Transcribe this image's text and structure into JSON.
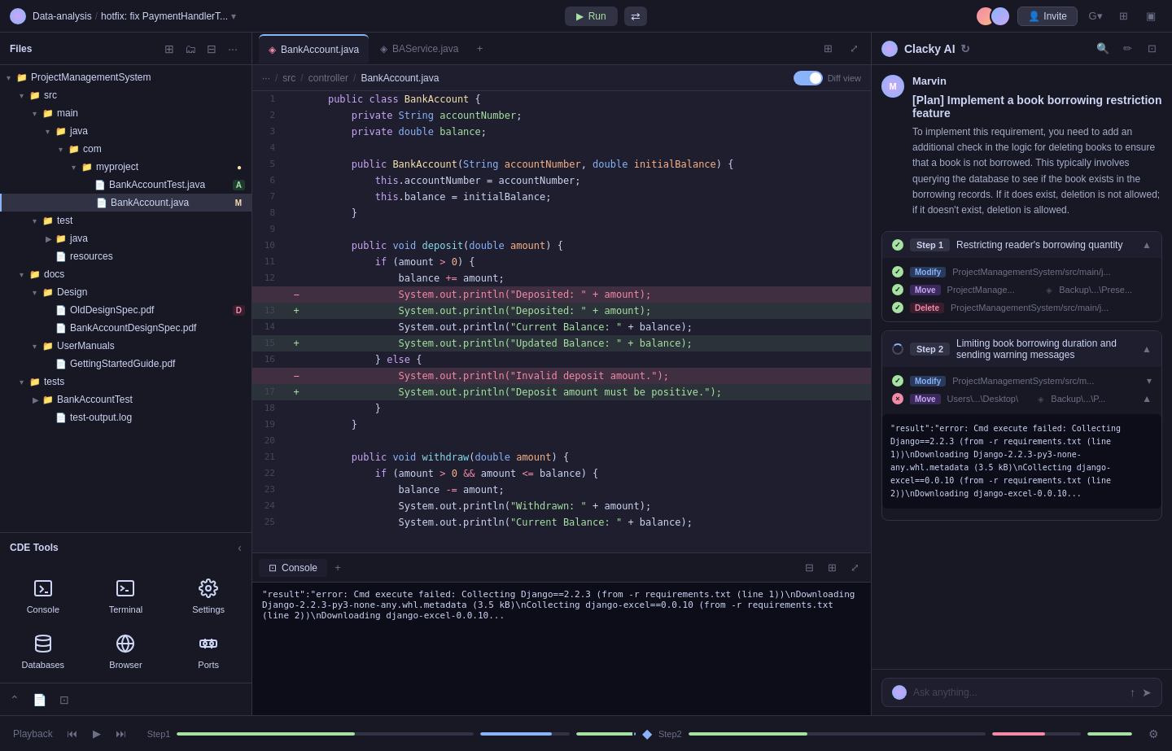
{
  "topbar": {
    "logo": "logo",
    "breadcrumb": [
      "Data-analysis",
      "/",
      "hotfix: fix PaymentHandlerT..."
    ],
    "run_label": "Run",
    "invite_label": "Invite"
  },
  "sidebar": {
    "title": "Files",
    "tree": [
      {
        "id": "root",
        "name": "ProjectManagementSystem",
        "type": "folder",
        "depth": 0,
        "open": true
      },
      {
        "id": "src",
        "name": "src",
        "type": "folder",
        "depth": 1,
        "open": true
      },
      {
        "id": "main",
        "name": "main",
        "type": "folder",
        "depth": 2,
        "open": true
      },
      {
        "id": "java",
        "name": "java",
        "type": "folder",
        "depth": 3,
        "open": true
      },
      {
        "id": "com",
        "name": "com",
        "type": "folder",
        "depth": 4,
        "open": true
      },
      {
        "id": "myproject",
        "name": "myproject",
        "type": "folder",
        "depth": 5,
        "open": true,
        "badge": "●",
        "badge_color": "yellow"
      },
      {
        "id": "BankAccountTest",
        "name": "BankAccountTest.java",
        "type": "java",
        "depth": 6,
        "badge": "A",
        "badge_color": "green"
      },
      {
        "id": "BankAccount",
        "name": "BankAccount.java",
        "type": "java",
        "depth": 6,
        "active": true,
        "badge": "M",
        "badge_color": "yellow"
      },
      {
        "id": "test",
        "name": "test",
        "type": "folder",
        "depth": 2,
        "open": true
      },
      {
        "id": "testjava",
        "name": "java",
        "type": "folder",
        "depth": 3,
        "open": false
      },
      {
        "id": "resources",
        "name": "resources",
        "type": "file",
        "depth": 3
      },
      {
        "id": "docs",
        "name": "docs",
        "type": "folder",
        "depth": 1,
        "open": true
      },
      {
        "id": "Design",
        "name": "Design",
        "type": "folder",
        "depth": 2,
        "open": true
      },
      {
        "id": "OldDesign",
        "name": "OldDesignSpec.pdf",
        "type": "pdf",
        "depth": 3,
        "badge": "D",
        "badge_color": "red"
      },
      {
        "id": "BankDesign",
        "name": "BankAccountDesignSpec.pdf",
        "type": "pdf",
        "depth": 3
      },
      {
        "id": "UserManuals",
        "name": "UserManuals",
        "type": "folder",
        "depth": 2,
        "open": true
      },
      {
        "id": "GettingStarted",
        "name": "GettingStartedGuide.pdf",
        "type": "pdf",
        "depth": 3
      },
      {
        "id": "tests",
        "name": "tests",
        "type": "folder",
        "depth": 1,
        "open": true
      },
      {
        "id": "BankAccountTestDir",
        "name": "BankAccountTest",
        "type": "folder",
        "depth": 2,
        "open": false
      },
      {
        "id": "testOutput",
        "name": "test-output.log",
        "type": "log",
        "depth": 3
      }
    ]
  },
  "cde_tools": {
    "title": "CDE Tools",
    "items": [
      {
        "id": "console",
        "label": "Console",
        "icon": "console"
      },
      {
        "id": "terminal",
        "label": "Terminal",
        "icon": "terminal"
      },
      {
        "id": "settings",
        "label": "Settings",
        "icon": "settings"
      },
      {
        "id": "databases",
        "label": "Databases",
        "icon": "databases"
      },
      {
        "id": "browser",
        "label": "Browser",
        "icon": "browser"
      },
      {
        "id": "ports",
        "label": "Ports",
        "icon": "ports"
      }
    ]
  },
  "editor": {
    "tabs": [
      {
        "id": "bankaccount",
        "label": "BankAccount.java",
        "active": true
      },
      {
        "id": "baservice",
        "label": "BAService.java",
        "active": false
      }
    ],
    "breadcrumb": [
      "src",
      "/",
      "controller",
      "/",
      "BankAccount.java"
    ],
    "diff_view_label": "Diff view",
    "diff_enabled": true,
    "lines": [
      {
        "num": 1,
        "content": "    public class BankAccount {",
        "diff": ""
      },
      {
        "num": 2,
        "content": "        private String accountNumber;",
        "diff": ""
      },
      {
        "num": 3,
        "content": "        private double balance;",
        "diff": ""
      },
      {
        "num": 4,
        "content": "",
        "diff": ""
      },
      {
        "num": 5,
        "content": "        public BankAccount(String accountNumber, double initialBalance) {",
        "diff": ""
      },
      {
        "num": 6,
        "content": "            this.accountNumber = accountNumber;",
        "diff": ""
      },
      {
        "num": 7,
        "content": "            this.balance = initialBalance;",
        "diff": ""
      },
      {
        "num": 8,
        "content": "        }",
        "diff": ""
      },
      {
        "num": 9,
        "content": "",
        "diff": ""
      },
      {
        "num": 10,
        "content": "        public void deposit(double amount) {",
        "diff": ""
      },
      {
        "num": 11,
        "content": "            if (amount > 0) {",
        "diff": ""
      },
      {
        "num": 12,
        "content": "                balance += amount;",
        "diff": ""
      },
      {
        "num": "",
        "content": "                System.out.println(\"Deposited: \" + amount);",
        "diff": "removed"
      },
      {
        "num": 13,
        "content": "                System.out.println(\"Deposited: \" + amount);",
        "diff": "added"
      },
      {
        "num": 14,
        "content": "                System.out.println(\"Current Balance: \" + balance);",
        "diff": ""
      },
      {
        "num": 15,
        "content": "                System.out.println(\"Updated Balance: \" + balance);",
        "diff": "added"
      },
      {
        "num": 16,
        "content": "            } else {",
        "diff": ""
      },
      {
        "num": "",
        "content": "                System.out.println(\"Invalid deposit amount.\");",
        "diff": "removed"
      },
      {
        "num": 17,
        "content": "                System.out.println(\"Deposit amount must be positive.\");",
        "diff": "added"
      },
      {
        "num": 18,
        "content": "            }",
        "diff": ""
      },
      {
        "num": 19,
        "content": "        }",
        "diff": ""
      },
      {
        "num": 20,
        "content": "",
        "diff": ""
      },
      {
        "num": 21,
        "content": "        public void withdraw(double amount) {",
        "diff": ""
      },
      {
        "num": 22,
        "content": "            if (amount > 0 && amount <= balance) {",
        "diff": ""
      },
      {
        "num": 23,
        "content": "                balance -= amount;",
        "diff": ""
      },
      {
        "num": 24,
        "content": "                System.out.println(\"Withdrawn: \" + amount);",
        "diff": ""
      }
    ]
  },
  "console": {
    "tab_label": "Console",
    "output": "\"result\":\"error: Cmd execute failed: Collecting Django==2.2.3 (from -r requirements.txt (line 1))\\nDownloading Django-2.2.3-py3-none-any.whl.metadata (3.5 kB)\\nCollecting django-excel==0.0.10 (from -r requirements.txt (line 2))\\nDownloading django-excel-0.0.10..."
  },
  "ai_panel": {
    "title": "Clacky AI",
    "agent_name": "Marvin",
    "plan_title": "[Plan] Implement a book borrowing restriction feature",
    "plan_text": "To implement this requirement, you need to add an additional check in the logic for deleting books to ensure that a book is not borrowed. This typically involves querying the database to see if the book exists in the borrowing records. If it does exist, deletion is not allowed; if it doesn't exist, deletion is allowed.",
    "steps": [
      {
        "id": "step1",
        "label": "Step 1",
        "title": "Restricting reader's borrowing quantity",
        "status": "done",
        "items": [
          {
            "action": "Modify",
            "path": "ProjectManagementSystem/src/main/j...",
            "status": "done"
          },
          {
            "action": "Move",
            "path": "ProjectManage...",
            "arrow": "Backup\\...\\Prese...",
            "status": "done"
          },
          {
            "action": "Delete",
            "path": "ProjectManagementSystem/src/main/j...",
            "status": "done"
          }
        ]
      },
      {
        "id": "step2",
        "label": "Step 2",
        "title": "Limiting book borrowing duration and sending warning messages",
        "status": "running",
        "items": [
          {
            "action": "Modify",
            "path": "ProjectManagementSystem/src/m...",
            "status": "done",
            "expandable": true
          },
          {
            "action": "Move",
            "path": "Users\\...\\Desktop\\",
            "arrow": "Backup\\...\\P...",
            "status": "error",
            "expandable": true
          }
        ]
      }
    ],
    "console_output": "\"result\":\"error: Cmd execute failed: Collecting Django==2.2.3 (from -r requirements.txt (line 1))\\nDownloading Django-2.2.3-py3-none-any.whl.metadata (3.5 kB)\\nCollecting django-excel==0.0.10 (from -r requirements.txt (line 2))\\nDownloading django-excel-0.0.10...",
    "input_placeholder": "Ask anything..."
  },
  "bottom_bar": {
    "playback_label": "Playback",
    "step1_label": "Step1",
    "step2_label": "Step2"
  }
}
